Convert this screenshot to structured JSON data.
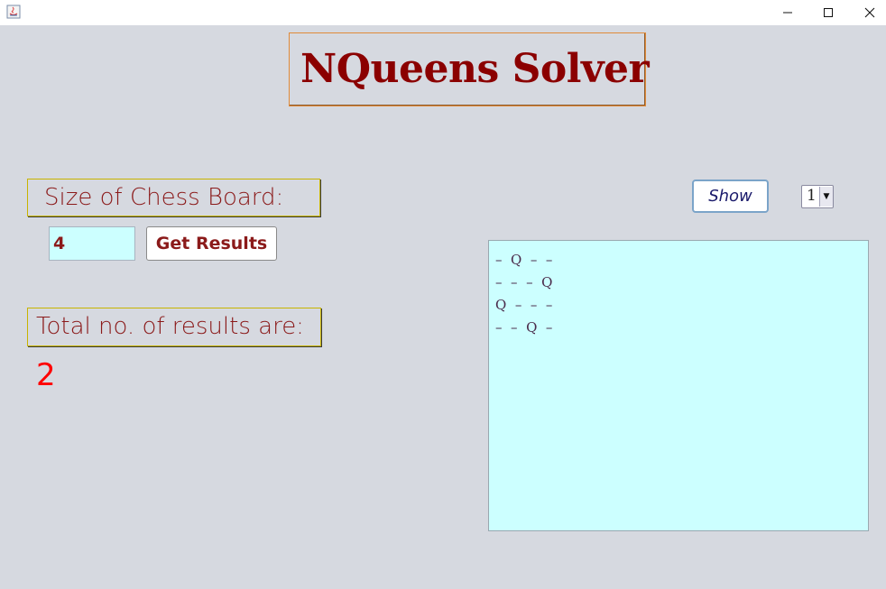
{
  "window": {
    "icon": "java-icon",
    "controls": [
      "minimize-icon",
      "maximize-icon",
      "close-icon"
    ]
  },
  "title": "NQueens Solver",
  "size_label": "Size of Chess Board:",
  "size_input_value": "4",
  "get_results_label": "Get Results",
  "total_label": "Total no. of results are:",
  "total_count": "2",
  "show_label": "Show",
  "solution_select_value": "1",
  "board_rows": [
    "–  Q  –  –",
    "–  –  –  Q",
    "Q  –  –  –",
    "–  –  Q  –"
  ],
  "colors": {
    "background": "#d6d9e0",
    "accent": "#8b0000",
    "count": "#ff0000",
    "board_bg": "#ccffff"
  }
}
